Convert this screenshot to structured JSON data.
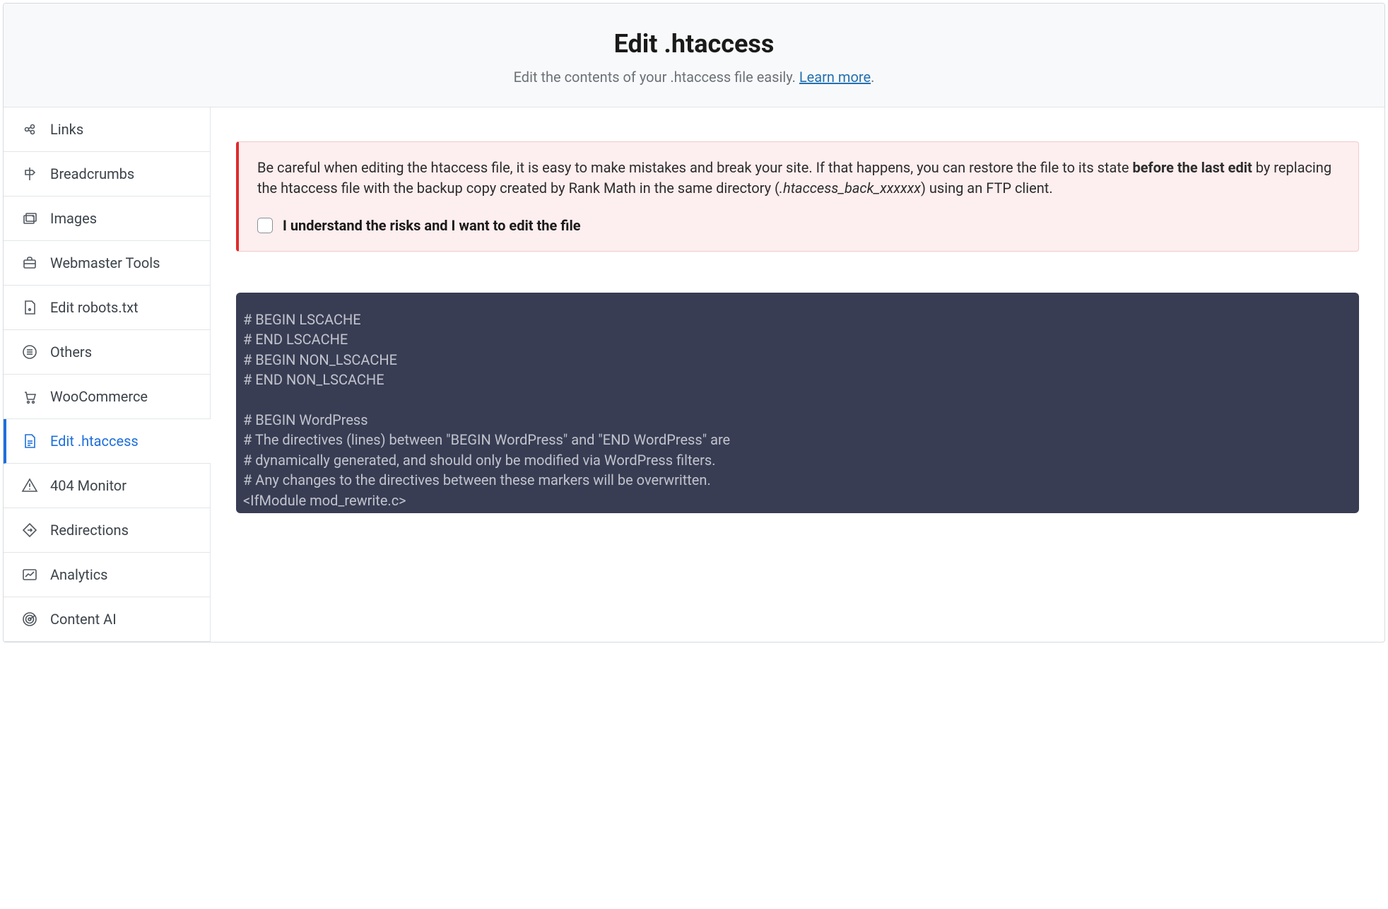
{
  "header": {
    "title": "Edit .htaccess",
    "subtitle_prefix": "Edit the contents of your .htaccess file easily. ",
    "learn_more": "Learn more",
    "subtitle_suffix": "."
  },
  "sidebar": {
    "items": [
      {
        "id": "links",
        "label": "Links",
        "icon": "links",
        "active": false
      },
      {
        "id": "breadcrumbs",
        "label": "Breadcrumbs",
        "icon": "signpost",
        "active": false
      },
      {
        "id": "images",
        "label": "Images",
        "icon": "images",
        "active": false
      },
      {
        "id": "webmaster-tools",
        "label": "Webmaster Tools",
        "icon": "briefcase",
        "active": false
      },
      {
        "id": "edit-robots",
        "label": "Edit robots.txt",
        "icon": "file-robot",
        "active": false
      },
      {
        "id": "others",
        "label": "Others",
        "icon": "list-circle",
        "active": false
      },
      {
        "id": "woocommerce",
        "label": "WooCommerce",
        "icon": "cart",
        "active": false
      },
      {
        "id": "edit-htaccess",
        "label": "Edit .htaccess",
        "icon": "file-text",
        "active": true
      },
      {
        "id": "404-monitor",
        "label": "404 Monitor",
        "icon": "warning",
        "active": false
      },
      {
        "id": "redirections",
        "label": "Redirections",
        "icon": "diamond-arrow",
        "active": false
      },
      {
        "id": "analytics",
        "label": "Analytics",
        "icon": "chart",
        "active": false
      },
      {
        "id": "content-ai",
        "label": "Content AI",
        "icon": "radar",
        "active": false
      }
    ]
  },
  "warning": {
    "text_part1": "Be careful when editing the htaccess file, it is easy to make mistakes and break your site. If that happens, you can restore the file to its state ",
    "bold": "before the last edit",
    "text_part2": " by replacing the htaccess file with the backup copy created by Rank Math in the same directory (",
    "backup_name": ".htaccess_back_xxxxxx",
    "text_part3": ") using an FTP client.",
    "consent_label": "I understand the risks and I want to edit the file"
  },
  "code": "# BEGIN LSCACHE\n# END LSCACHE\n# BEGIN NON_LSCACHE\n# END NON_LSCACHE\n\n# BEGIN WordPress\n# The directives (lines) between \"BEGIN WordPress\" and \"END WordPress\" are\n# dynamically generated, and should only be modified via WordPress filters.\n# Any changes to the directives between these markers will be overwritten.\n<IfModule mod_rewrite.c>\nRewriteEngine On"
}
